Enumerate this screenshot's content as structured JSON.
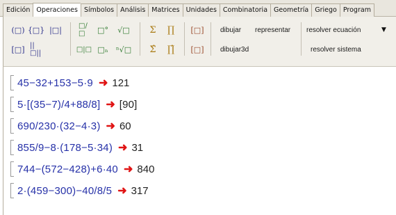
{
  "tabs": [
    "Edición",
    "Operaciones",
    "Símbolos",
    "Análisis",
    "Matrices",
    "Unidades",
    "Combinatoria",
    "Geometría",
    "Griego",
    "Program"
  ],
  "toolbar": {
    "row1_icons": [
      "(□)",
      "{□}",
      "|□|",
      "□/□",
      "□°",
      "√□",
      "Σ",
      "∏",
      "[□]"
    ],
    "row2_icons": [
      "[□]",
      "||□||",
      "□|□",
      "□ₙ",
      "ⁿ√□",
      "Σ̂",
      "∏̂",
      "[□]"
    ],
    "dibujar": "dibujar",
    "representar": "representar",
    "dibujar3d": "dibujar3d",
    "resolver_ecuacion": "resolver ecuación",
    "resolver_sistema": "resolver sistema",
    "dropdown_arrow": "▼"
  },
  "arrow_glyph": "➜",
  "rows": [
    {
      "expr": "45−32+153−5·9",
      "result": "121"
    },
    {
      "expr": "5·[(35−7)/4+88/8]",
      "result": "[90]"
    },
    {
      "expr": "690/230·(32−4·3)",
      "result": "60"
    },
    {
      "expr": "855/9−8·(178−5·34)",
      "result": "31"
    },
    {
      "expr": "744−(572−428)+6·40",
      "result": "840"
    },
    {
      "expr": "2·(459−300)−40/8/5",
      "result": "317"
    }
  ]
}
